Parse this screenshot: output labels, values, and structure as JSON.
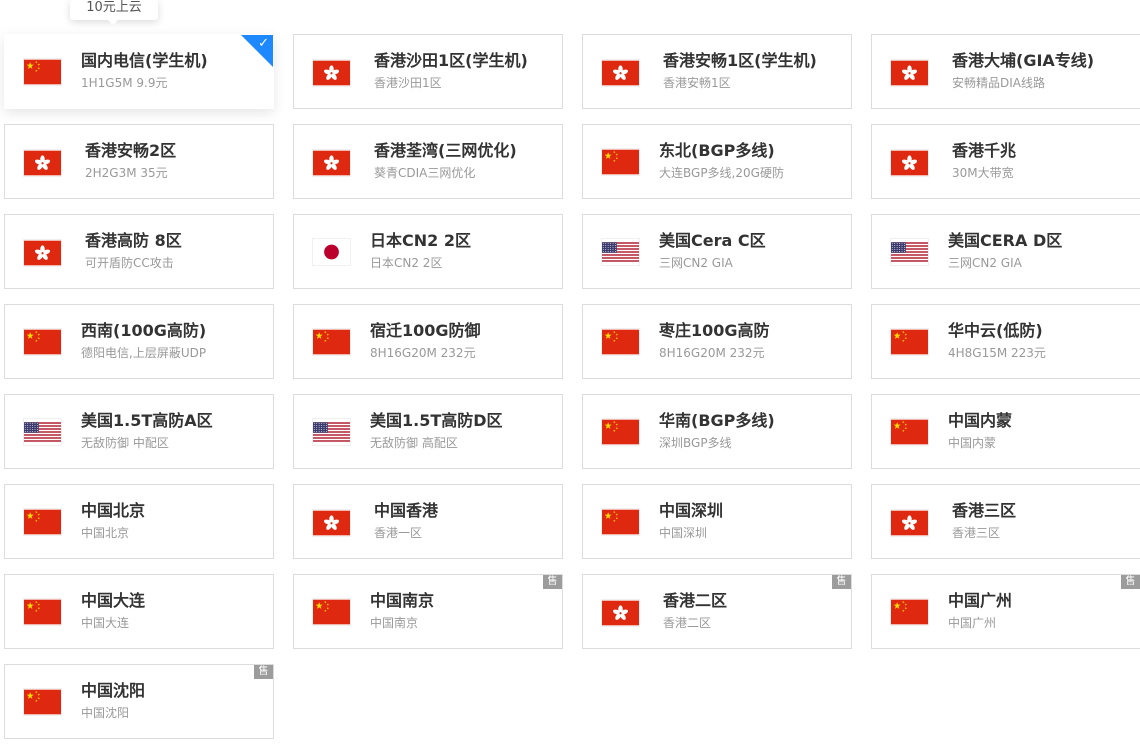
{
  "tooltip": "10元上云",
  "colors": {
    "accent": "#1e88ff",
    "badge": "#9c9c9c"
  },
  "regions": [
    {
      "title": "国内电信(学生机)",
      "subtitle": "1H1G5M 9.9元",
      "flag": "cn",
      "selected": true,
      "badge": ""
    },
    {
      "title": "香港沙田1区(学生机)",
      "subtitle": "香港沙田1区",
      "flag": "hk",
      "selected": false,
      "badge": ""
    },
    {
      "title": "香港安畅1区(学生机)",
      "subtitle": "香港安畅1区",
      "flag": "hk",
      "selected": false,
      "badge": ""
    },
    {
      "title": "香港大埔(GIA专线)",
      "subtitle": "安畅精品DIA线路",
      "flag": "hk",
      "selected": false,
      "badge": ""
    },
    {
      "title": "香港安畅2区",
      "subtitle": "2H2G3M 35元",
      "flag": "hk",
      "selected": false,
      "badge": ""
    },
    {
      "title": "香港荃湾(三网优化)",
      "subtitle": "葵青CDIA三网优化",
      "flag": "hk",
      "selected": false,
      "badge": ""
    },
    {
      "title": "东北(BGP多线)",
      "subtitle": "大连BGP多线,20G硬防",
      "flag": "cn",
      "selected": false,
      "badge": ""
    },
    {
      "title": "香港千兆",
      "subtitle": "30M大带宽",
      "flag": "hk",
      "selected": false,
      "badge": ""
    },
    {
      "title": "香港高防 8区",
      "subtitle": "可开盾防CC攻击",
      "flag": "hk",
      "selected": false,
      "badge": ""
    },
    {
      "title": "日本CN2 2区",
      "subtitle": "日本CN2 2区",
      "flag": "jp",
      "selected": false,
      "badge": ""
    },
    {
      "title": "美国Cera C区",
      "subtitle": "三网CN2 GIA",
      "flag": "us",
      "selected": false,
      "badge": ""
    },
    {
      "title": "美国CERA D区",
      "subtitle": "三网CN2 GIA",
      "flag": "us",
      "selected": false,
      "badge": ""
    },
    {
      "title": "西南(100G高防)",
      "subtitle": "德阳电信,上层屏蔽UDP",
      "flag": "cn",
      "selected": false,
      "badge": ""
    },
    {
      "title": "宿迁100G防御",
      "subtitle": "8H16G20M 232元",
      "flag": "cn",
      "selected": false,
      "badge": ""
    },
    {
      "title": "枣庄100G高防",
      "subtitle": "8H16G20M 232元",
      "flag": "cn",
      "selected": false,
      "badge": ""
    },
    {
      "title": "华中云(低防)",
      "subtitle": "4H8G15M 223元",
      "flag": "cn",
      "selected": false,
      "badge": ""
    },
    {
      "title": "美国1.5T高防A区",
      "subtitle": "无敌防御 中配区",
      "flag": "us",
      "selected": false,
      "badge": ""
    },
    {
      "title": "美国1.5T高防D区",
      "subtitle": "无敌防御 高配区",
      "flag": "us",
      "selected": false,
      "badge": ""
    },
    {
      "title": "华南(BGP多线)",
      "subtitle": "深圳BGP多线",
      "flag": "cn",
      "selected": false,
      "badge": ""
    },
    {
      "title": "中国内蒙",
      "subtitle": "中国内蒙",
      "flag": "cn",
      "selected": false,
      "badge": ""
    },
    {
      "title": "中国北京",
      "subtitle": "中国北京",
      "flag": "cn",
      "selected": false,
      "badge": ""
    },
    {
      "title": "中国香港",
      "subtitle": "香港一区",
      "flag": "hk",
      "selected": false,
      "badge": ""
    },
    {
      "title": "中国深圳",
      "subtitle": "中国深圳",
      "flag": "cn",
      "selected": false,
      "badge": ""
    },
    {
      "title": "香港三区",
      "subtitle": "香港三区",
      "flag": "hk",
      "selected": false,
      "badge": ""
    },
    {
      "title": "中国大连",
      "subtitle": "中国大连",
      "flag": "cn",
      "selected": false,
      "badge": ""
    },
    {
      "title": "中国南京",
      "subtitle": "中国南京",
      "flag": "cn",
      "selected": false,
      "badge": "售罄"
    },
    {
      "title": "香港二区",
      "subtitle": "香港二区",
      "flag": "hk",
      "selected": false,
      "badge": "售罄"
    },
    {
      "title": "中国广州",
      "subtitle": "中国广州",
      "flag": "cn",
      "selected": false,
      "badge": "售罄"
    },
    {
      "title": "中国沈阳",
      "subtitle": "中国沈阳",
      "flag": "cn",
      "selected": false,
      "badge": "售罄"
    }
  ]
}
